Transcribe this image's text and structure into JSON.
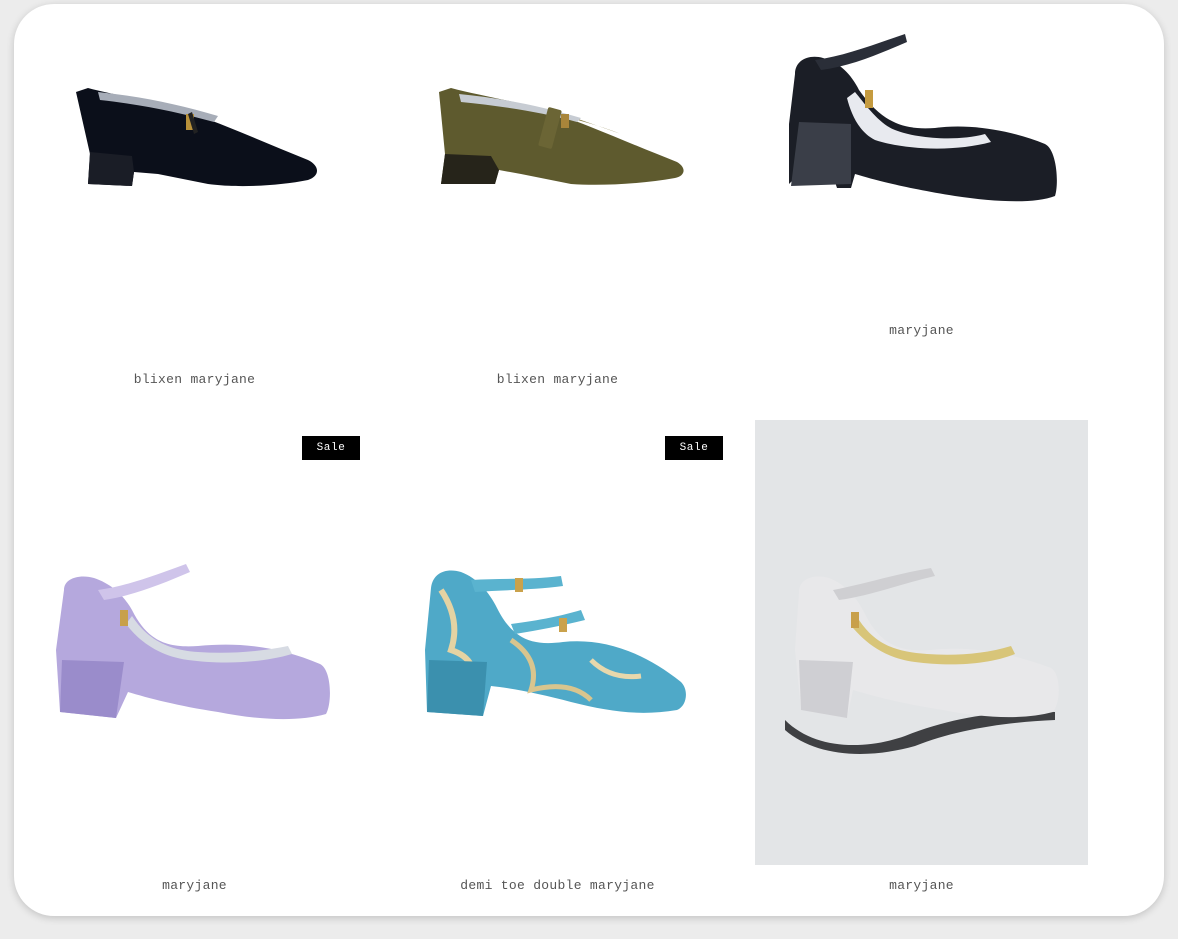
{
  "products": [
    {
      "title": "blixen maryjane",
      "image_icon": "black-suede-maryjane-shoe-image",
      "sale": ""
    },
    {
      "title": "blixen maryjane",
      "image_icon": "gold-metallic-maryjane-shoe-image",
      "sale": ""
    },
    {
      "title": "maryjane",
      "image_icon": "black-patent-maryjane-shoe-image",
      "sale": ""
    },
    {
      "title": "maryjane",
      "image_icon": "lavender-suede-maryjane-shoe-image",
      "sale": "Sale"
    },
    {
      "title": "demi toe double maryjane",
      "image_icon": "blue-jacquard-double-maryjane-shoe-image",
      "sale": "Sale"
    },
    {
      "title": "maryjane",
      "image_icon": "white-leather-maryjane-shoe-image",
      "sale": ""
    }
  ],
  "colors": {
    "page_bg": "#ececec",
    "card_bg": "#ffffff",
    "badge_bg": "#000000",
    "badge_text": "#ffffff",
    "title_text": "#555555"
  }
}
